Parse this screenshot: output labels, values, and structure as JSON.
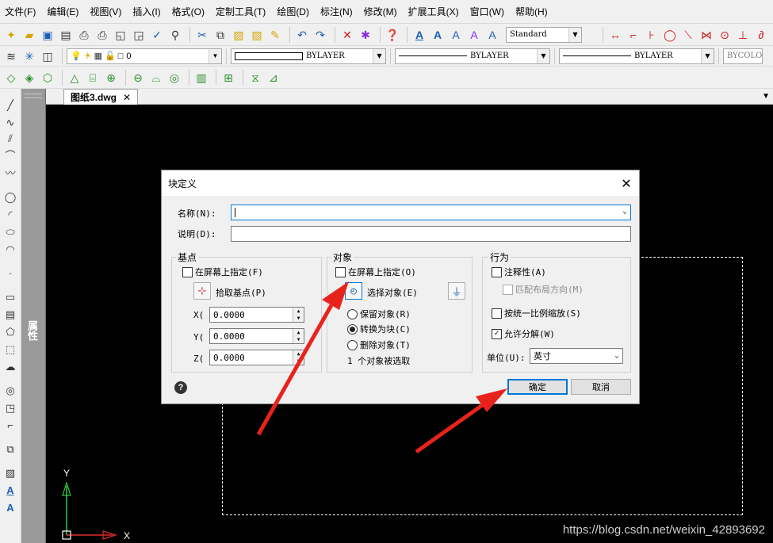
{
  "menu": [
    {
      "label": "文件(F)"
    },
    {
      "label": "编辑(E)"
    },
    {
      "label": "视图(V)"
    },
    {
      "label": "插入(I)"
    },
    {
      "label": "格式(O)"
    },
    {
      "label": "定制工具(T)"
    },
    {
      "label": "绘图(D)"
    },
    {
      "label": "标注(N)"
    },
    {
      "label": "修改(M)"
    },
    {
      "label": "扩展工具(X)"
    },
    {
      "label": "窗口(W)"
    },
    {
      "label": "帮助(H)"
    }
  ],
  "toolbar": {
    "text_style": "Standard",
    "layer": "0",
    "color": "BYLAYER",
    "linetype": "BYLAYER",
    "lineweight": "BYLAYER",
    "plot_style": "BYCOLOR"
  },
  "tab": {
    "label": "图纸3.dwg",
    "close": "✕"
  },
  "properties_panel": {
    "label": "属性"
  },
  "ucs": {
    "x": "X",
    "y": "Y"
  },
  "watermark": "https://blog.csdn.net/weixin_42893692",
  "dialog": {
    "title": "块定义",
    "close": "✕",
    "name_label": "名称(N):",
    "name_value": "",
    "desc_label": "说明(D):",
    "desc_value": "",
    "base_point": {
      "title": "基点",
      "specify_on_screen": "在屏幕上指定(F)",
      "pick_label": "拾取基点(P)",
      "x_label": "X(",
      "y_label": "Y(",
      "z_label": "Z(",
      "x": "0.0000",
      "y": "0.0000",
      "z": "0.0000"
    },
    "objects": {
      "title": "对象",
      "specify_on_screen": "在屏幕上指定(O)",
      "select_label": "选择对象(E)",
      "retain": "保留对象(R)",
      "convert": "转换为块(C)",
      "delete": "删除对象(T)",
      "selected_info": "1 个对象被选取"
    },
    "behavior": {
      "title": "行为",
      "annotative": "注释性(A)",
      "match_orientation": "匹配布局方向(M)",
      "scale_uniform": "按统一比例缩放(S)",
      "allow_explode": "允许分解(W)",
      "unit_label": "单位(U):",
      "unit_value": "英寸"
    },
    "ok": "确定",
    "cancel": "取消",
    "help": "?"
  },
  "colors": {
    "arrow": "#e8231c",
    "focus": "#0078d7",
    "canvas": "#000000"
  }
}
